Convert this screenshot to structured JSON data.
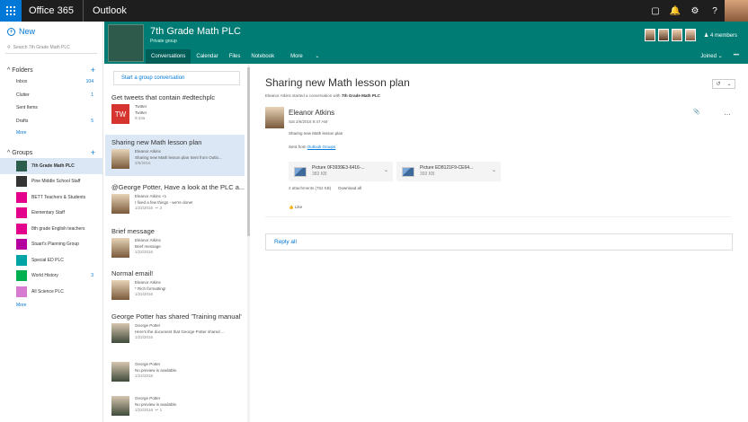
{
  "topbar": {
    "brand": "Office 365",
    "app": "Outlook",
    "icons": [
      "square",
      "bell",
      "gear",
      "?"
    ]
  },
  "left": {
    "new_label": "New",
    "search_placeholder": "Search 7th Grade Math PLC",
    "folders_title": "Folders",
    "folders": [
      {
        "label": "Inbox",
        "count": "104"
      },
      {
        "label": "Clutter",
        "count": "1"
      },
      {
        "label": "Sent Items",
        "count": ""
      },
      {
        "label": "Drafts",
        "count": "5"
      }
    ],
    "folders_more": "More",
    "groups_title": "Groups",
    "groups": [
      {
        "label": "7th Grade Math PLC",
        "count": "",
        "color": "#2d5d4c"
      },
      {
        "label": "Pine Middle School Staff",
        "count": "",
        "color": "#333333"
      },
      {
        "label": "BETT Teachers & Students",
        "count": "",
        "color": "#e3008c"
      },
      {
        "label": "Elementary Staff",
        "count": "",
        "color": "#e3008c"
      },
      {
        "label": "8th grade English teachers",
        "count": "",
        "color": "#e3008c"
      },
      {
        "label": "Stuart's Planning Group",
        "count": "",
        "color": "#b4009e"
      },
      {
        "label": "Special ED PLC",
        "count": "",
        "color": "#00a4a6"
      },
      {
        "label": "World History",
        "count": "3",
        "color": "#00b050"
      },
      {
        "label": "All Science PLC",
        "count": "",
        "color": "#d77bd0"
      }
    ],
    "groups_more": "More"
  },
  "banner": {
    "title": "7th Grade Math PLC",
    "subtitle": "Private group",
    "tabs": [
      "Conversations",
      "Calendar",
      "Files",
      "Notebook",
      "More"
    ],
    "members": "4 members",
    "joined": "Joined",
    "more_dots": "•••"
  },
  "list": {
    "start_placeholder": "Start a group conversation",
    "items": [
      {
        "title": "Get tweets that contain #edtechplc",
        "sender": "Twitter",
        "preview": "Twitter",
        "date": "9:43a",
        "avatar": "TW"
      },
      {
        "title": "Sharing new Math lesson plan",
        "sender": "Eleanor Atkins",
        "preview": "Sharing new Math lesson plan  Sent from Outlo...",
        "date": "2/6/2016"
      },
      {
        "title": "@George Potter, Have a look at the PLC a...",
        "sender": "Eleanor Atkins +1",
        "preview": "I fixed a few things - we're done!",
        "date": "1/22/2016",
        "extra": "2"
      },
      {
        "title": "Brief message",
        "sender": "Eleanor Atkins",
        "preview": "Brief message",
        "date": "1/22/2016"
      },
      {
        "title": "Normal email!",
        "sender": "Eleanor Atkins",
        "preview": "* Rich formatting!",
        "date": "1/22/2016"
      },
      {
        "title": "George Potter has shared 'Training manual'",
        "sender": "George Potter",
        "preview": "Here's the document that George Potter shared ...",
        "date": "1/22/2016"
      },
      {
        "title": "",
        "sender": "George Potter",
        "preview": "No preview is available.",
        "date": "1/22/2016"
      },
      {
        "title": "",
        "sender": "George Potter",
        "preview": "No preview is available.",
        "date": "1/22/2016",
        "extra": "1"
      }
    ]
  },
  "reading": {
    "title": "Sharing new Math lesson plan",
    "started_prefix": "Eleanor Atkins started a conversation with",
    "started_group": "7th Grade Math PLC",
    "sender": "Eleanor Atkins",
    "date": "Sat 2/6/2016 9:47 AM",
    "body": "Sharing new Math lesson plan",
    "sent_from": "Sent from",
    "sent_link": "Outlook Groups",
    "attachments": [
      {
        "name": "Picture 0F3939E3-6416-...",
        "size": "383 KB"
      },
      {
        "name": "Picture ED8121F9-CE64...",
        "size": "393 KB"
      }
    ],
    "attach_summary": "2 attachments (752 KB)",
    "download_all": "Download all",
    "like": "Like",
    "reply_all": "Reply all"
  }
}
